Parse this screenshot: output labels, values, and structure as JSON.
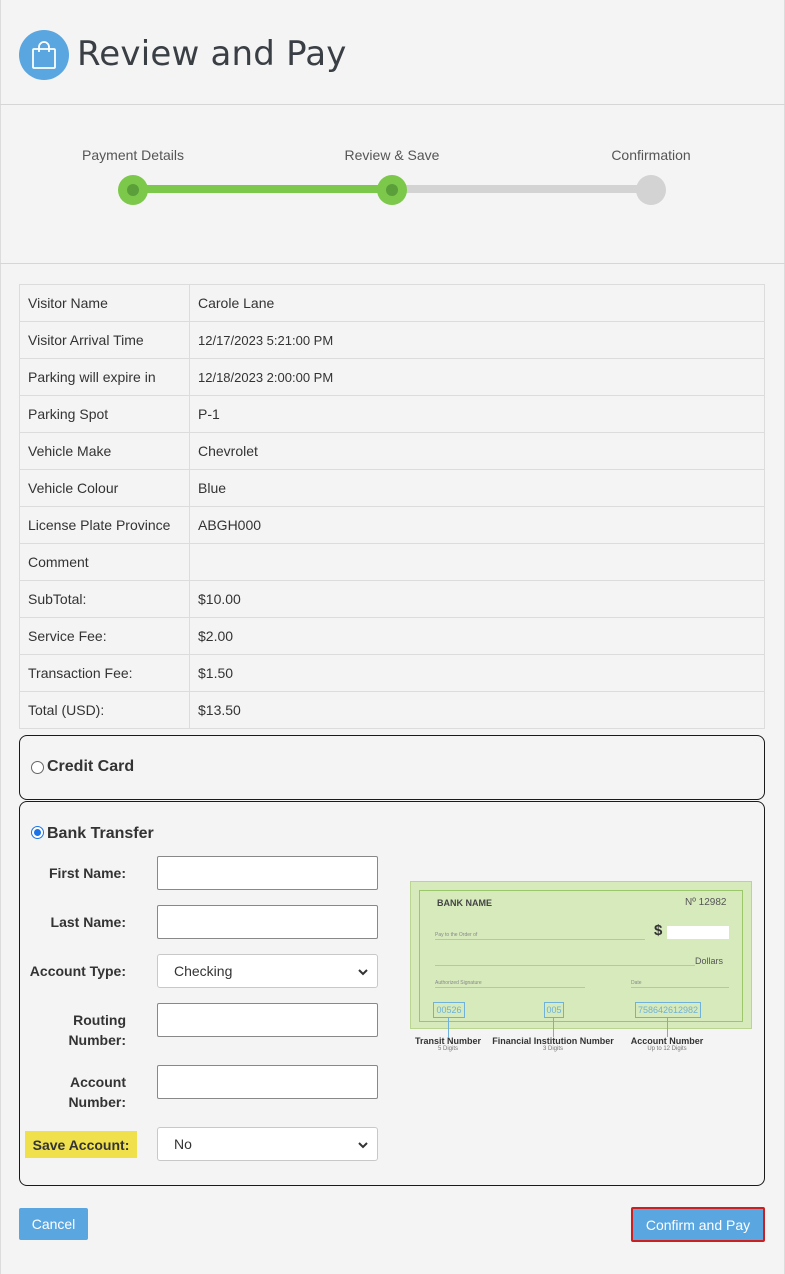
{
  "header": {
    "title": "Review and Pay",
    "icon": "shopping-bag-icon"
  },
  "stepper": {
    "steps": [
      {
        "label": "Payment Details",
        "state": "complete"
      },
      {
        "label": "Review & Save",
        "state": "current"
      },
      {
        "label": "Confirmation",
        "state": "pending"
      }
    ]
  },
  "summary": {
    "rows": [
      {
        "label": "Visitor Name",
        "value": "Carole Lane"
      },
      {
        "label": "Visitor Arrival Time",
        "value": "12/17/2023 5:21:00 PM"
      },
      {
        "label": "Parking will expire in",
        "value": " 12/18/2023 2:00:00 PM"
      },
      {
        "label": "Parking Spot",
        "value": "P-1"
      },
      {
        "label": "Vehicle Make",
        "value": "Chevrolet"
      },
      {
        "label": "Vehicle Colour",
        "value": "Blue"
      },
      {
        "label": "License Plate Province",
        "value": "ABGH000"
      },
      {
        "label": "Comment",
        "value": ""
      },
      {
        "label": "SubTotal:",
        "value": "$10.00"
      },
      {
        "label": "Service Fee:",
        "value": "$2.00"
      },
      {
        "label": "Transaction Fee:",
        "value": "$1.50"
      },
      {
        "label": "Total (USD):",
        "value": "$13.50"
      }
    ]
  },
  "payment": {
    "credit_card_label": "Credit Card",
    "bank_transfer_label": "Bank Transfer",
    "selected": "bank_transfer",
    "form": {
      "first_name_label": "First Name:",
      "first_name_value": "",
      "last_name_label": "Last Name:",
      "last_name_value": "",
      "account_type_label": "Account Type:",
      "account_type_value": "Checking",
      "routing_label_1": "Routing",
      "routing_label_2": "Number:",
      "routing_value": "",
      "account_label_1": "Account",
      "account_label_2": "Number:",
      "account_value": "",
      "save_account_label": "Save Account:",
      "save_account_value": "No"
    },
    "cheque": {
      "bank_name": "BANK NAME",
      "cheque_no": "Nº 12982",
      "pay_to": "Pay to the Order of",
      "dollar_sign": "$",
      "dollars": "Dollars",
      "signature": "Authorized Signature",
      "date": "Date",
      "transit_digits": "00526",
      "institution_digits": "005",
      "account_digits": "758642612982",
      "transit_caption": "Transit Number",
      "transit_sub": "5 Digits",
      "institution_caption": "Financial Institution Number",
      "institution_sub": "3 Digits",
      "account_caption": "Account Number",
      "account_sub": "Up to 12 Digits"
    }
  },
  "actions": {
    "cancel_label": "Cancel",
    "confirm_label": "Confirm and Pay"
  },
  "colors": {
    "accent": "#5aa6e0",
    "step_done": "#7cc84a",
    "highlight": "#f0e04c",
    "confirm_border": "#cc1f1f"
  }
}
